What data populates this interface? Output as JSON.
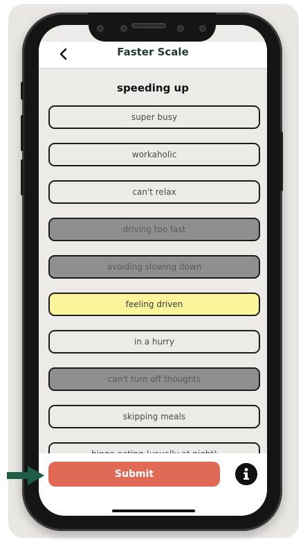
{
  "header": {
    "title": "Faster Scale",
    "back_icon": "chevron-left-icon"
  },
  "section": {
    "title": "speeding up"
  },
  "options": [
    {
      "label": "super busy",
      "state": "unselected"
    },
    {
      "label": "workaholic",
      "state": "unselected"
    },
    {
      "label": "can't relax",
      "state": "unselected"
    },
    {
      "label": "driving too fast",
      "state": "grey"
    },
    {
      "label": "avoiding slowing down",
      "state": "grey"
    },
    {
      "label": "feeling driven",
      "state": "yellow"
    },
    {
      "label": "in a hurry",
      "state": "unselected"
    },
    {
      "label": "can't turn off thoughts",
      "state": "grey"
    },
    {
      "label": "skipping meals",
      "state": "unselected"
    },
    {
      "label": "binge eating (usually at night)",
      "state": "unselected"
    }
  ],
  "footer": {
    "submit_label": "Submit",
    "info_icon": "info-icon"
  },
  "colors": {
    "submit": "#e06a55",
    "selected_grey": "#8f8f8f",
    "selected_yellow": "#faf59a",
    "arrow": "#1f5c45",
    "title": "#1f3b2e"
  },
  "annotation": {
    "icon": "arrow-right-icon"
  }
}
